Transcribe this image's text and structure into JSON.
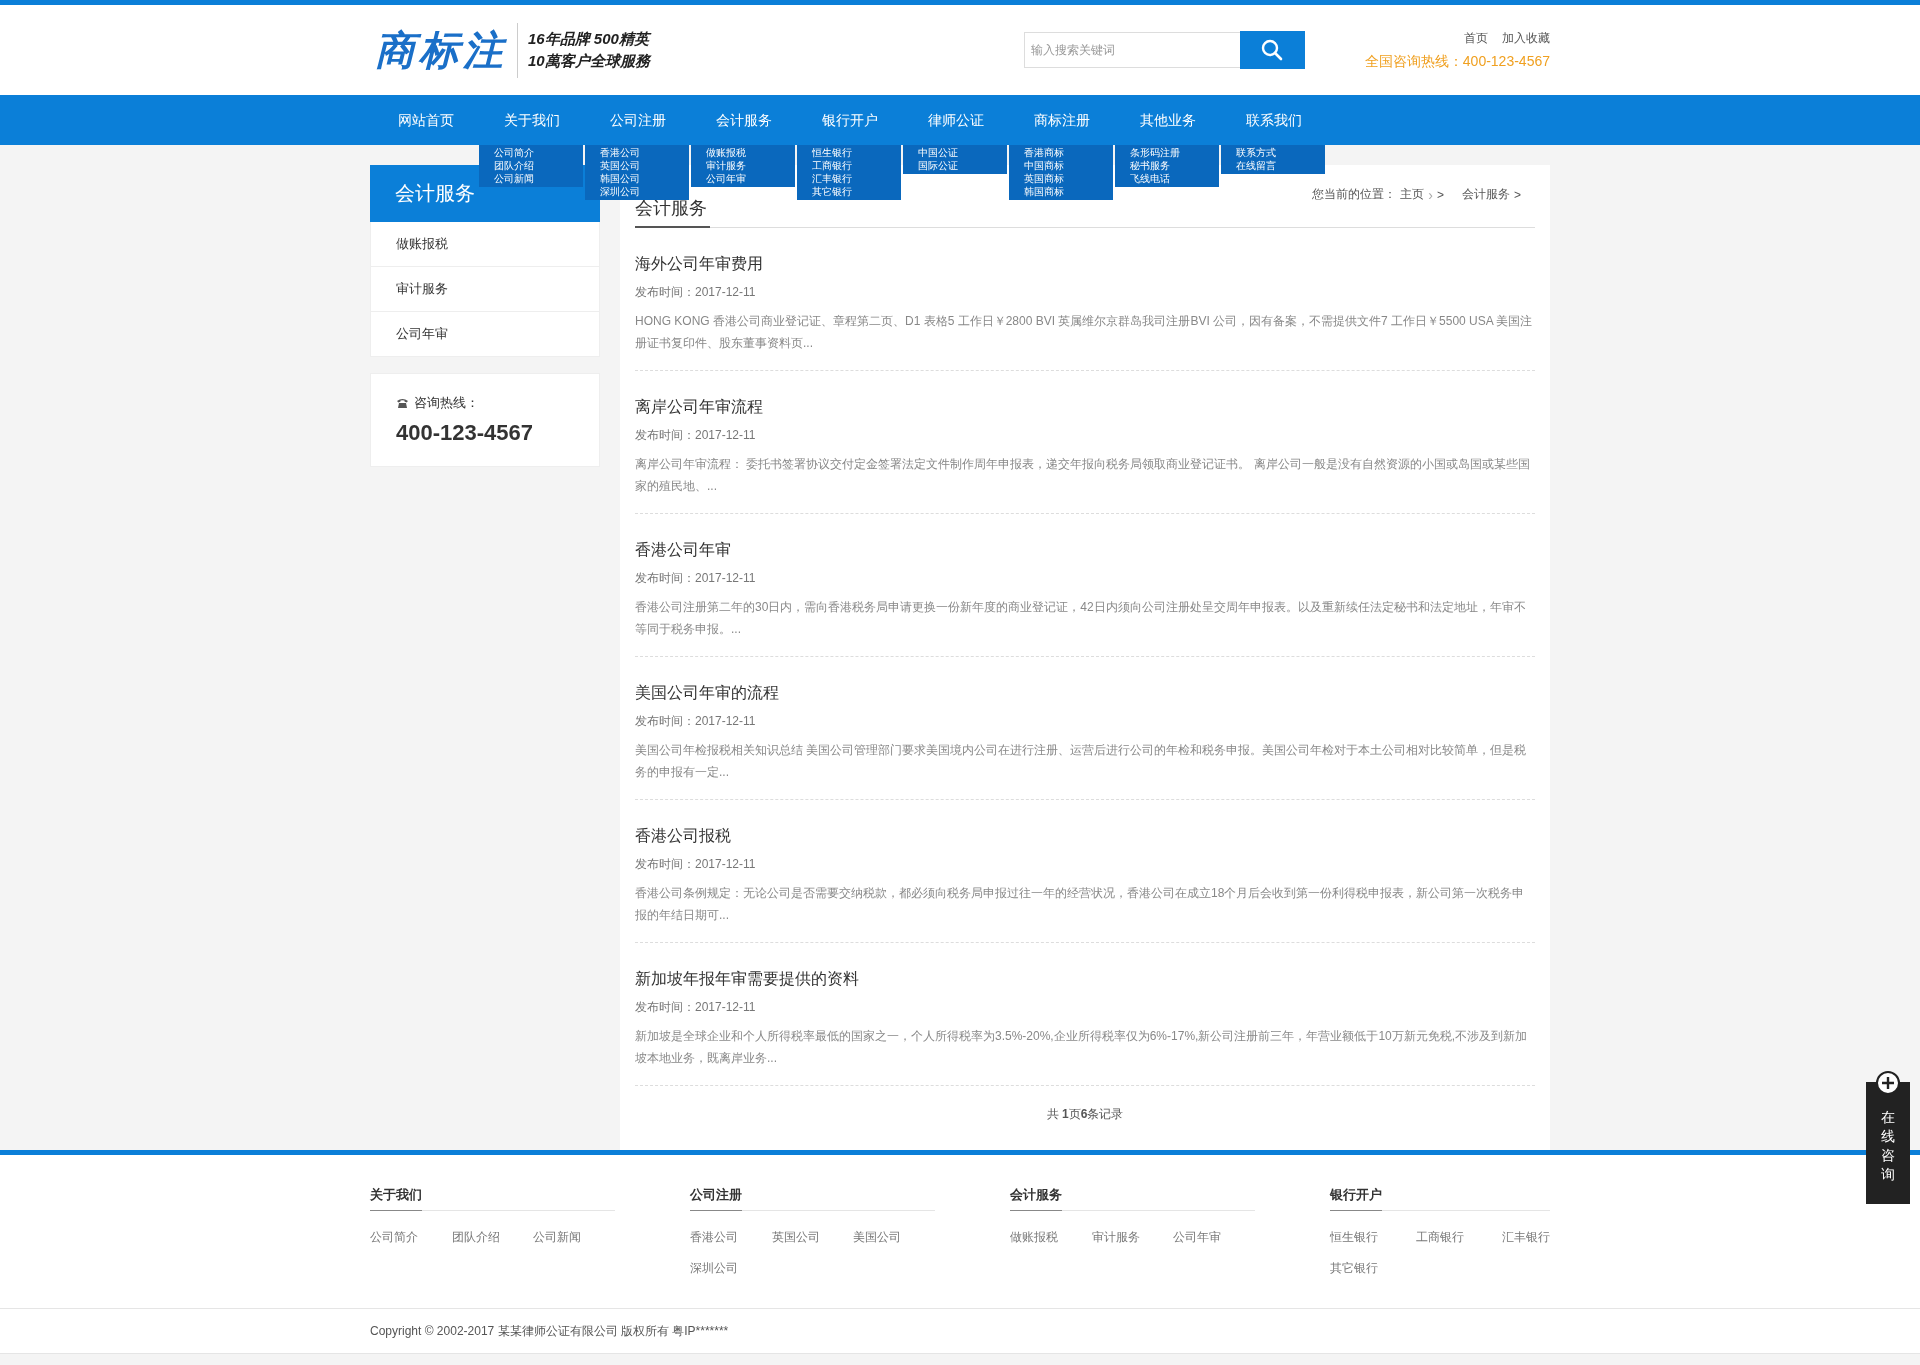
{
  "header": {
    "logo": "商标注",
    "slogan": [
      "16年品牌 500精英",
      "10萬客户全球服務"
    ],
    "search": {
      "placeholder": "输入搜索关键词"
    },
    "links": [
      "首页",
      "加入收藏"
    ],
    "hotline": "全国咨询热线：400-123-4567"
  },
  "nav": [
    {
      "label": "网站首页"
    },
    {
      "label": "关于我们",
      "submenu": [
        "公司简介",
        "团队介绍",
        "公司新闻"
      ]
    },
    {
      "label": "公司注册",
      "submenu": [
        "香港公司",
        "英国公司",
        "韩国公司",
        "深圳公司"
      ]
    },
    {
      "label": "会计服务",
      "submenu": [
        "做账报税",
        "审计服务",
        "公司年审"
      ]
    },
    {
      "label": "银行开户",
      "submenu": [
        "恒生银行",
        "工商银行",
        "汇丰银行",
        "其它银行"
      ]
    },
    {
      "label": "律师公证",
      "submenu": [
        "中国公证",
        "国际公证"
      ]
    },
    {
      "label": "商标注册",
      "submenu": [
        "香港商标",
        "中国商标",
        "英国商标",
        "韩国商标"
      ]
    },
    {
      "label": "其他业务",
      "submenu": [
        "条形码注册",
        "秘书服务",
        "飞线电话"
      ]
    },
    {
      "label": "联系我们",
      "submenu": [
        "联系方式",
        "在线留言"
      ]
    }
  ],
  "sidebar": {
    "title": "会计服务",
    "items": [
      {
        "label": "做账报税"
      },
      {
        "label": "审计服务"
      },
      {
        "label": "公司年审"
      }
    ],
    "hotline_label": "咨询热线：",
    "hotline_number": "400-123-4567"
  },
  "content": {
    "title": "会计服务",
    "breadcrumb": {
      "prefix": "您当前的位置：",
      "items": [
        {
          "label": "主页",
          "separators": [
            "›",
            ">"
          ]
        },
        {
          "label": "会计服务",
          "separators": [
            ">"
          ]
        }
      ]
    },
    "articles": [
      {
        "title": "海外公司年审费用",
        "date": "发布时间：2017-12-11",
        "summary": "HONG KONG 香港公司商业登记证、章程第二页、D1 表格5 工作日￥2800 BVI 英属维尔京群岛我司注册BVI 公司，因有备案，不需提供文件7 工作日￥5500 USA 美国注册证书复印件、股东董事资料页..."
      },
      {
        "title": "离岸公司年审流程",
        "date": "发布时间：2017-12-11",
        "summary": "离岸公司年审流程： 委托书签署协议交付定金签署法定文件制作周年申报表，递交年报向税务局领取商业登记证书。 离岸公司一般是没有自然资源的小国或岛国或某些国家的殖民地、..."
      },
      {
        "title": "香港公司年审",
        "date": "发布时间：2017-12-11",
        "summary": "香港公司注册第二年的30日内，需向香港税务局申请更换一份新年度的商业登记证，42日内须向公司注册处呈交周年申报表。以及重新续任法定秘书和法定地址，年审不等同于税务申报。..."
      },
      {
        "title": "美国公司年审的流程",
        "date": "发布时间：2017-12-11",
        "summary": "美国公司年检报税相关知识总结 美国公司管理部门要求美国境内公司在进行注册、运营后进行公司的年检和税务申报。美国公司年检对于本土公司相对比较简单，但是税务的申报有一定..."
      },
      {
        "title": "香港公司报税",
        "date": "发布时间：2017-12-11",
        "summary": "香港公司条例规定：无论公司是否需要交纳税款，都必须向税务局申报过往一年的经营状况，香港公司在成立18个月后会收到第一份利得税申报表，新公司第一次税务申报的年结日期可..."
      },
      {
        "title": "新加坡年报年审需要提供的资料",
        "date": "发布时间：2017-12-11",
        "summary": "新加坡是全球企业和个人所得税率最低的国家之一，个人所得税率为3.5%-20%,企业所得税率仅为6%-17%,新公司注册前三年，年营业额低于10万新元免税,不涉及到新加坡本地业务，既离岸业务..."
      }
    ],
    "pagination": "共 **1**页**6**条记录"
  },
  "footer": {
    "columns": [
      {
        "title": "关于我们",
        "links": [
          "公司简介",
          "团队介绍",
          "公司新闻"
        ]
      },
      {
        "title": "公司注册",
        "links": [
          "香港公司",
          "英国公司",
          "美国公司",
          "深圳公司"
        ]
      },
      {
        "title": "会计服务",
        "links": [
          "做账报税",
          "审计服务",
          "公司年审"
        ]
      },
      {
        "title": "银行开户",
        "links": [
          "恒生银行",
          "工商银行",
          "汇丰银行",
          "其它银行"
        ]
      }
    ],
    "copyright": "Copyright © 2002-2017 某某律师公证有限公司 版权所有  粤IP*******"
  },
  "float_consult": {
    "label": "在线咨询"
  }
}
